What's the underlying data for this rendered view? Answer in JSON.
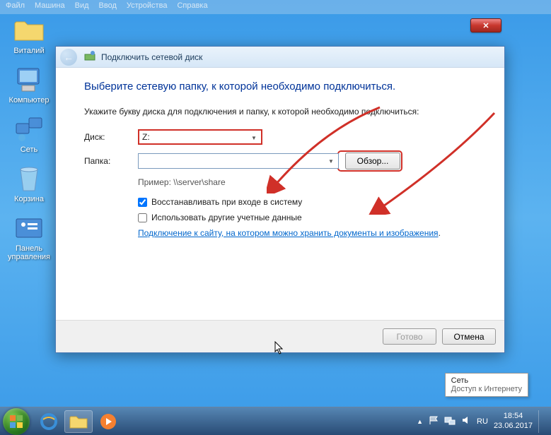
{
  "vm_menu": [
    "Файл",
    "Машина",
    "Вид",
    "Ввод",
    "Устройства",
    "Справка"
  ],
  "desktop_icons": [
    {
      "name": "folder-vitaly",
      "label": "Виталий"
    },
    {
      "name": "computer",
      "label": "Компьютер"
    },
    {
      "name": "network",
      "label": "Сеть"
    },
    {
      "name": "recycle-bin",
      "label": "Корзина"
    },
    {
      "name": "control-panel",
      "label": "Панель\nуправления"
    }
  ],
  "dialog": {
    "title": "Подключить сетевой диск",
    "heading": "Выберите сетевую папку, к которой необходимо подключиться.",
    "instruction": "Укажите букву диска для подключения и папку, к которой необходимо подключиться:",
    "drive_label": "Диск:",
    "drive_value": "Z:",
    "folder_label": "Папка:",
    "folder_value": "",
    "browse": "Обзор...",
    "example": "Пример: \\\\server\\share",
    "reconnect_label": "Восстанавливать при входе в систему",
    "reconnect_checked": true,
    "othercreds_label": "Использовать другие учетные данные",
    "othercreds_checked": false,
    "link": "Подключение к сайту, на котором можно хранить документы и изображения",
    "finish": "Готово",
    "cancel": "Отмена"
  },
  "tooltip": {
    "line1": "Сеть",
    "line2": "Доступ к Интернету"
  },
  "clock": {
    "time": "18:54",
    "date": "23.06.2017"
  },
  "lang": "RU"
}
